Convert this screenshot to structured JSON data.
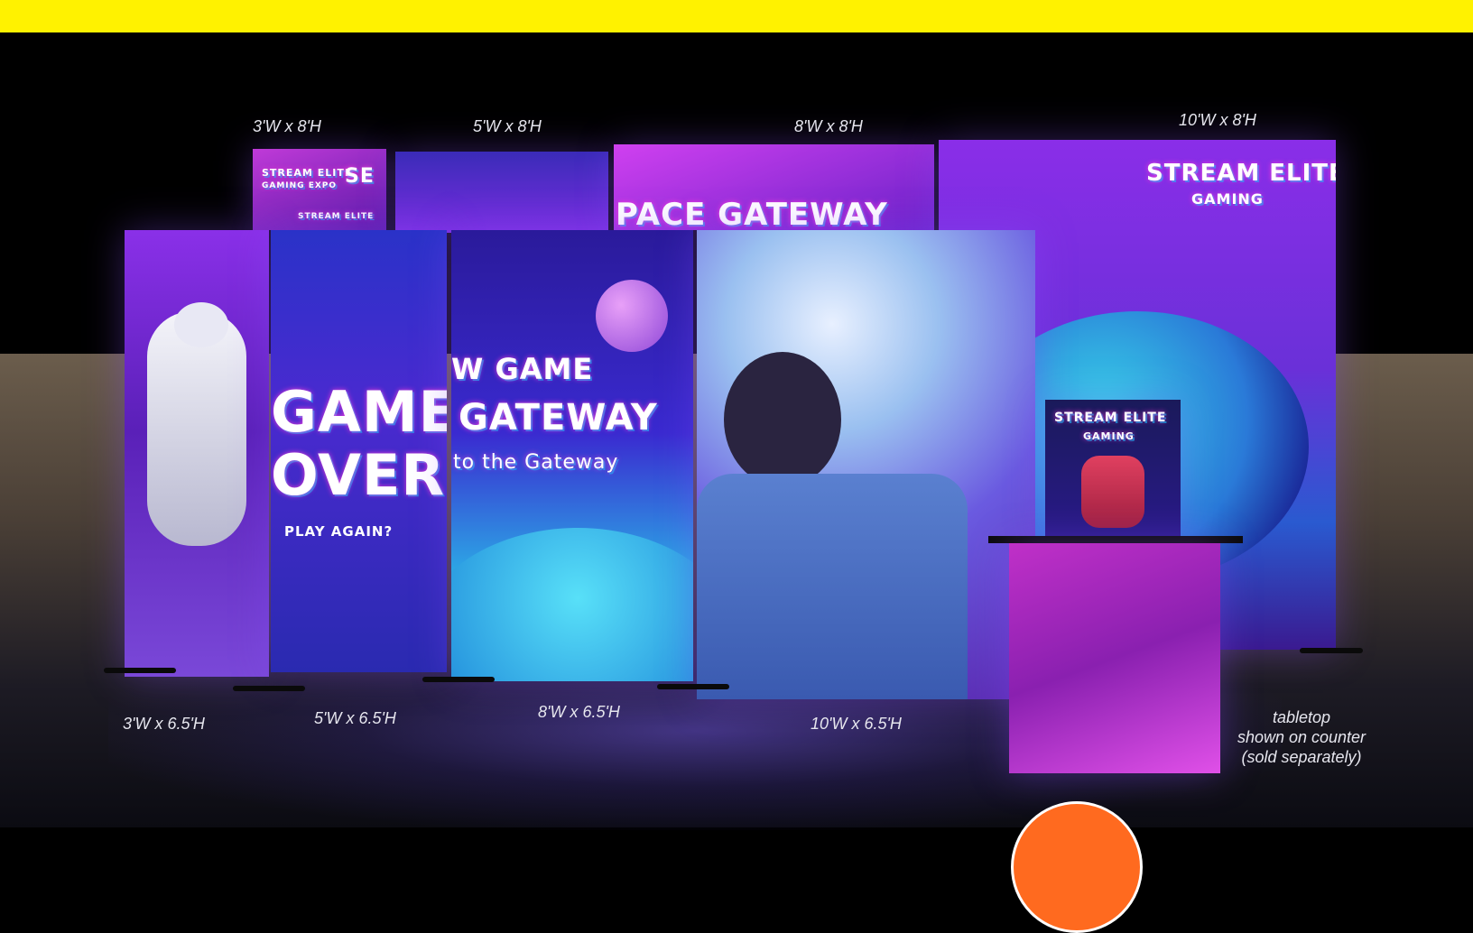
{
  "labels": {
    "back_3x8": "3'W x 8'H",
    "back_5x8": "5'W x 8'H",
    "back_8x8": "8'W x 8'H",
    "back_10x8": "10'W x 8'H",
    "front_3x65": "3'W x 6.5'H",
    "front_5x65": "5'W x 6.5'H",
    "front_8x65": "8'W x 6.5'H",
    "front_10x65": "10'W x 6.5'H",
    "tabletop_line1": "tabletop",
    "tabletop_line2": "shown on counter",
    "tabletop_line3": "(sold separately)"
  },
  "graphics": {
    "stream_elite": "STREAM ELITE",
    "gaming": "GAMING",
    "gaming_expo": "GAMING EXPO",
    "se": "SE",
    "space_gateway": "PACE GATEWAY",
    "game": "GAME",
    "over": "OVER",
    "play_again": "PLAY AGAIN?",
    "new_game": "W GAME",
    "gateway": "GATEWAY",
    "to_the_gateway": "to the Gateway"
  },
  "colors": {
    "top_bar": "#FFF200",
    "accent_orange": "#FF6A1F"
  }
}
